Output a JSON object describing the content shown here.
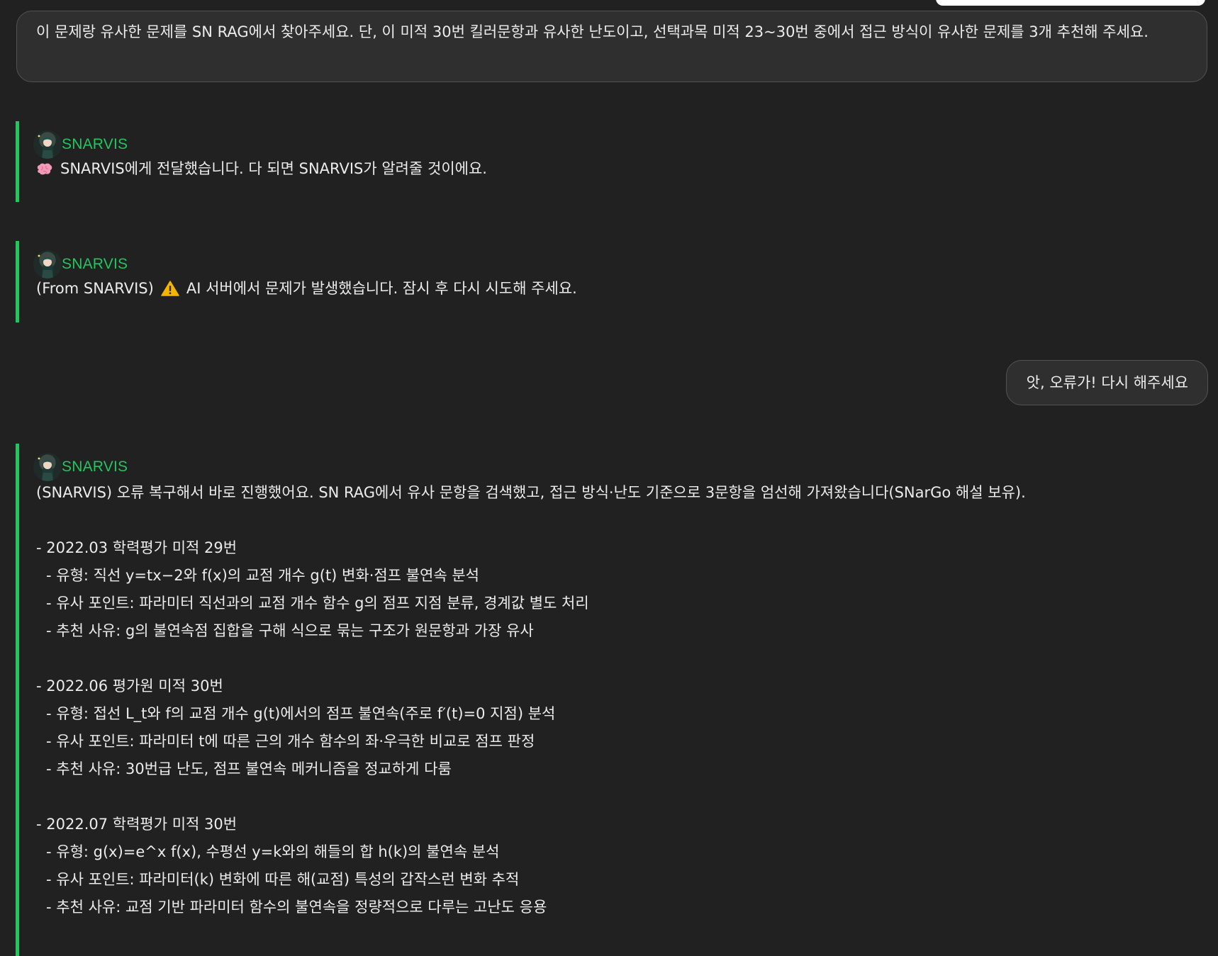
{
  "colors": {
    "background": "#212121",
    "bubble": "#2f2f2f",
    "bubble_border": "#525252",
    "accent_green": "#22c55e",
    "text": "#ececec"
  },
  "user_messages": [
    {
      "text": "이 문제랑 유사한 문제를 SN RAG에서 찾아주세요. 단, 이 미적 30번 킬러문항과 유사한 난도이고, 선택과목 미적 23~30번 중에서 접근 방식이 유사한 문제를 3개 추천해 주세요."
    },
    {
      "text": "앗, 오류가! 다시 해주세요"
    }
  ],
  "bot_messages": [
    {
      "sender": "SNARVIS",
      "icon": "brain-emoji",
      "text": "SNARVIS에게 전달했습니다. 다 되면 SNARVIS가 알려줄 것이에요."
    },
    {
      "sender": "SNARVIS",
      "prefix": "(From SNARVIS)",
      "icon": "warning-emoji",
      "text": "AI 서버에서 문제가 발생했습니다. 잠시 후 다시 시도해 주세요."
    },
    {
      "sender": "SNARVIS",
      "intro": "(SNARVIS) 오류 복구해서 바로 진행했어요. SN RAG에서 유사 문항을 검색했고, 접근 방식·난도 기준으로 3문항을 엄선해 가져왔습니다(SNarGo 해설 보유).",
      "recommendations": [
        {
          "title": "- 2022.03 학력평가 미적 29번",
          "type": "- 유형: 직선 y=tx−2와 f(x)의 교점 개수 g(t) 변화·점프 불연속 분석",
          "point": "- 유사 포인트: 파라미터 직선과의 교점 개수 함수 g의 점프 지점 분류, 경계값 별도 처리",
          "reason": "- 추천 사유: g의 불연속점 집합을 구해 식으로 묶는 구조가 원문항과 가장 유사"
        },
        {
          "title": "- 2022.06 평가원 미적 30번",
          "type": "- 유형: 접선 L_t와 f의 교점 개수 g(t)에서의 점프 불연속(주로 f′(t)=0 지점) 분석",
          "point": "- 유사 포인트: 파라미터 t에 따른 근의 개수 함수의 좌·우극한 비교로 점프 판정",
          "reason": "- 추천 사유: 30번급 난도, 점프 불연속 메커니즘을 정교하게 다룸"
        },
        {
          "title": "- 2022.07 학력평가 미적 30번",
          "type": "- 유형: g(x)=e^x f(x), 수평선 y=k와의 해들의 합 h(k)의 불연속 분석",
          "point": "- 유사 포인트: 파라미터(k) 변화에 따른 해(교점) 특성의 갑작스런 변화 추적",
          "reason": "- 추천 사유: 교점 기반 파라미터 함수의 불연속을 정량적으로 다루는 고난도 응용"
        }
      ]
    }
  ]
}
